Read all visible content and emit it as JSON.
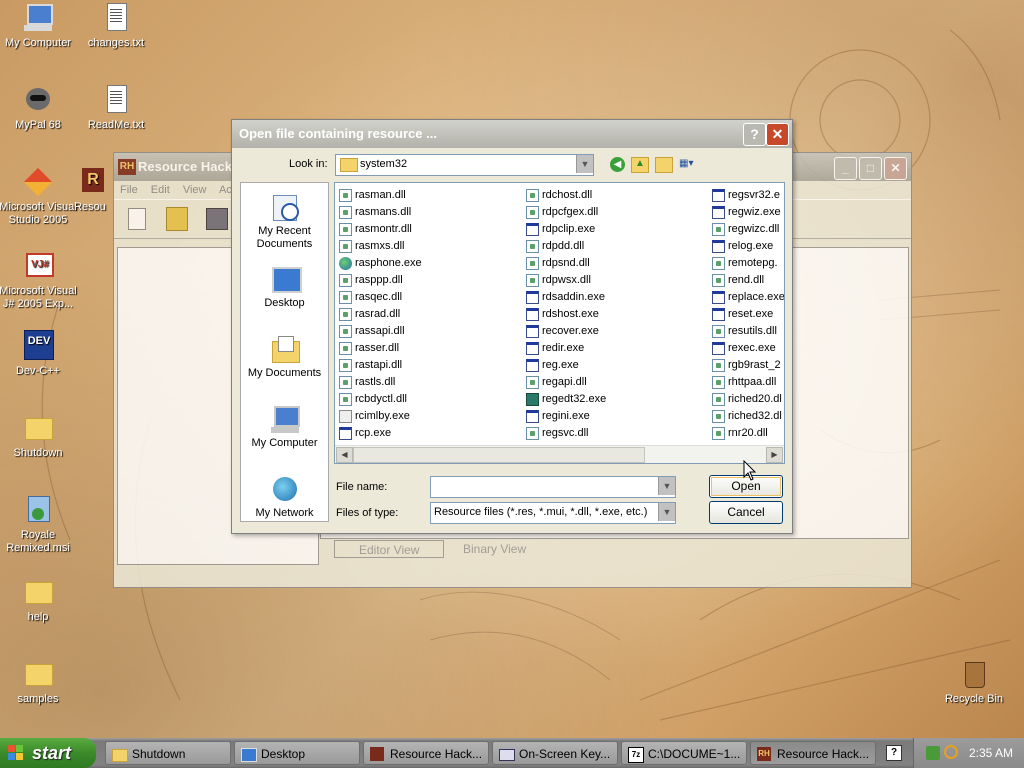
{
  "desktop": {
    "icons": [
      {
        "label": "My Computer"
      },
      {
        "label": "changes.txt"
      },
      {
        "label": "MyPal 68"
      },
      {
        "label": "ReadMe.txt"
      },
      {
        "label": "Microsoft Visual Studio 2005"
      },
      {
        "label": "Microsoft Visual J# 2005 Exp..."
      },
      {
        "label": "Dev-C++"
      },
      {
        "label": "Shutdown"
      },
      {
        "label": "Royale Remixed.msi"
      },
      {
        "label": "help"
      },
      {
        "label": "samples"
      },
      {
        "label": "Recycle Bin"
      },
      {
        "label": "Resou"
      }
    ]
  },
  "background_window": {
    "title": "Resource Hack",
    "logo": "RH",
    "menu": [
      "File",
      "Edit",
      "View",
      "Act"
    ],
    "tabs": [
      "Editor View",
      "Binary View"
    ]
  },
  "dialog": {
    "title": "Open file containing resource ...",
    "help_btn": "?",
    "close_btn": "✕",
    "look_in_label": "Look in:",
    "look_in_value": "system32",
    "places": [
      {
        "label": "My Recent Documents",
        "icon": "recent-documents-icon"
      },
      {
        "label": "Desktop",
        "icon": "desktop-icon"
      },
      {
        "label": "My Documents",
        "icon": "my-documents-icon"
      },
      {
        "label": "My Computer",
        "icon": "my-computer-icon"
      },
      {
        "label": "My Network",
        "icon": "network-icon"
      }
    ],
    "files": {
      "col1": [
        {
          "name": "rasman.dll",
          "type": "dll"
        },
        {
          "name": "rasmans.dll",
          "type": "dll"
        },
        {
          "name": "rasmontr.dll",
          "type": "dll"
        },
        {
          "name": "rasmxs.dll",
          "type": "dll"
        },
        {
          "name": "rasphone.exe",
          "type": "globe"
        },
        {
          "name": "rasppp.dll",
          "type": "dll"
        },
        {
          "name": "rasqec.dll",
          "type": "dll"
        },
        {
          "name": "rasrad.dll",
          "type": "dll"
        },
        {
          "name": "rassapi.dll",
          "type": "dll"
        },
        {
          "name": "rasser.dll",
          "type": "dll"
        },
        {
          "name": "rastapi.dll",
          "type": "dll"
        },
        {
          "name": "rastls.dll",
          "type": "dll"
        },
        {
          "name": "rcbdyctl.dll",
          "type": "dll"
        },
        {
          "name": "rcimlby.exe",
          "type": "cdrom"
        },
        {
          "name": "rcp.exe",
          "type": "exe"
        }
      ],
      "col2": [
        {
          "name": "rdchost.dll",
          "type": "dll"
        },
        {
          "name": "rdpcfgex.dll",
          "type": "dll"
        },
        {
          "name": "rdpclip.exe",
          "type": "exe"
        },
        {
          "name": "rdpdd.dll",
          "type": "dll"
        },
        {
          "name": "rdpsnd.dll",
          "type": "dll"
        },
        {
          "name": "rdpwsx.dll",
          "type": "dll"
        },
        {
          "name": "rdsaddin.exe",
          "type": "exe"
        },
        {
          "name": "rdshost.exe",
          "type": "exe"
        },
        {
          "name": "recover.exe",
          "type": "exe"
        },
        {
          "name": "redir.exe",
          "type": "exe"
        },
        {
          "name": "reg.exe",
          "type": "exe"
        },
        {
          "name": "regapi.dll",
          "type": "dll"
        },
        {
          "name": "regedt32.exe",
          "type": "reg"
        },
        {
          "name": "regini.exe",
          "type": "exe"
        },
        {
          "name": "regsvc.dll",
          "type": "dll"
        }
      ],
      "col3": [
        {
          "name": "regsvr32.e",
          "type": "exe"
        },
        {
          "name": "regwiz.exe",
          "type": "exe"
        },
        {
          "name": "regwizc.dll",
          "type": "dll"
        },
        {
          "name": "relog.exe",
          "type": "exe"
        },
        {
          "name": "remotepg.",
          "type": "dll"
        },
        {
          "name": "rend.dll",
          "type": "dll"
        },
        {
          "name": "replace.exe",
          "type": "exe"
        },
        {
          "name": "reset.exe",
          "type": "exe"
        },
        {
          "name": "resutils.dll",
          "type": "dll"
        },
        {
          "name": "rexec.exe",
          "type": "exe"
        },
        {
          "name": "rgb9rast_2",
          "type": "dll"
        },
        {
          "name": "rhttpaa.dll",
          "type": "dll"
        },
        {
          "name": "riched20.dl",
          "type": "dll"
        },
        {
          "name": "riched32.dl",
          "type": "dll"
        },
        {
          "name": "rnr20.dll",
          "type": "dll"
        }
      ]
    },
    "file_name_label": "File name:",
    "file_name_value": "",
    "files_of_type_label": "Files of type:",
    "files_of_type_value": "Resource files (*.res, *.mui, *.dll, *.exe, etc.)",
    "open_label": "Open",
    "cancel_label": "Cancel"
  },
  "taskbar": {
    "start_label": "start",
    "tasks": [
      {
        "label": "Shutdown",
        "icon": "folder-icon"
      },
      {
        "label": "Desktop",
        "icon": "desktop-icon"
      },
      {
        "label": "Resource Hack...",
        "icon": "resource-hacker-icon"
      },
      {
        "label": "On-Screen Key...",
        "icon": "keyboard-icon"
      },
      {
        "label": "C:\\DOCUME~1...",
        "icon": "7zip-icon"
      },
      {
        "label": "Resource Hack...",
        "icon": "resource-hacker-icon"
      }
    ],
    "clock": "2:35 AM"
  },
  "colors": {
    "xp_green": "#3a8a2a",
    "title_grey": "#b2b2aa",
    "close_red": "#c8482a"
  }
}
